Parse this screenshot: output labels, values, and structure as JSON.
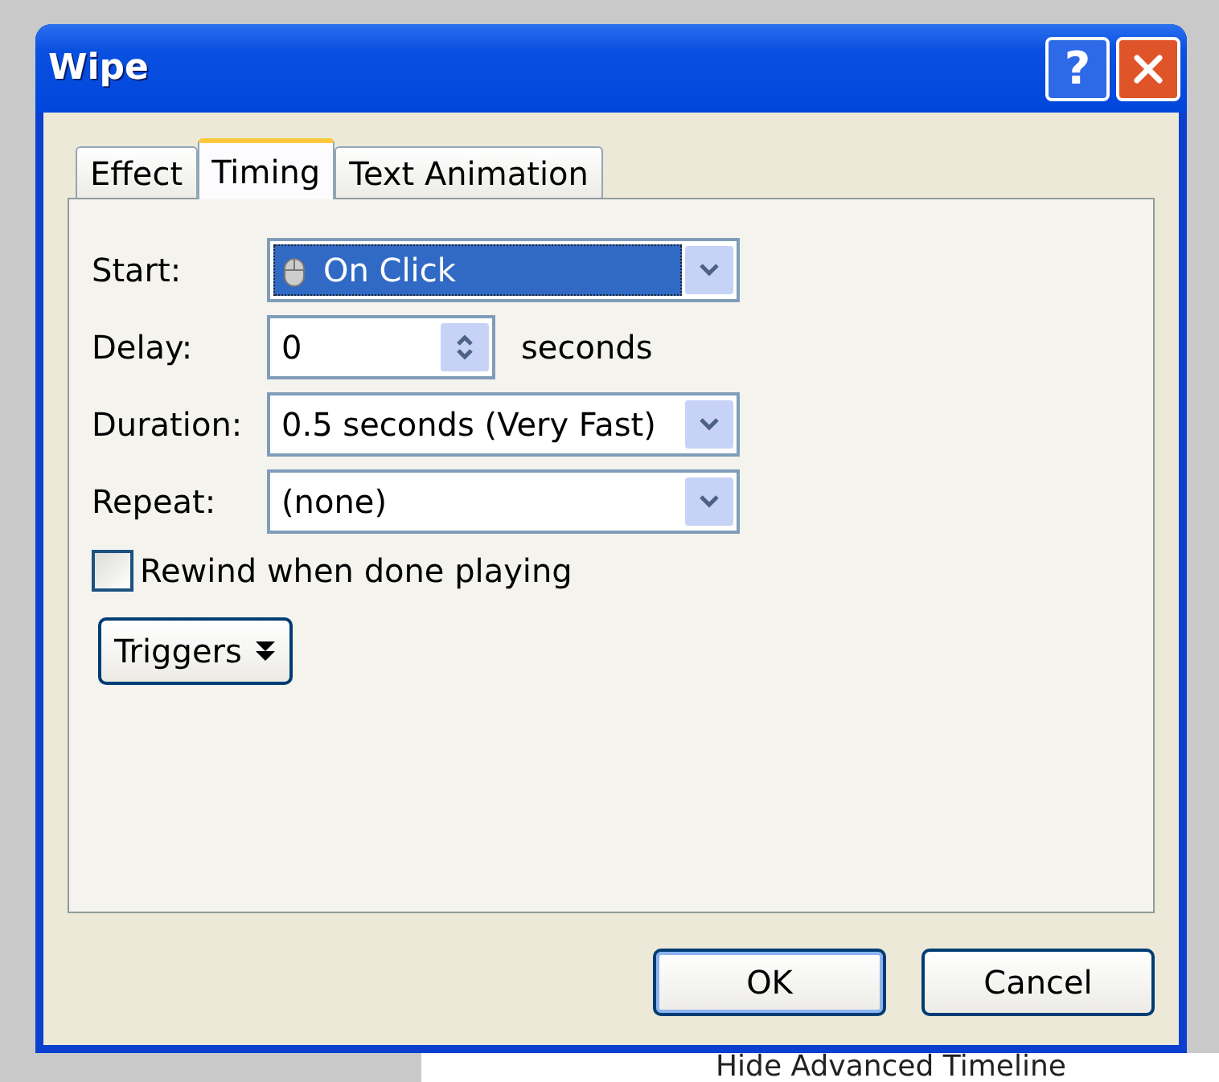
{
  "window": {
    "title": "Wipe",
    "help_button": "?"
  },
  "tabs": [
    {
      "label": "Effect",
      "selected": false
    },
    {
      "label": "Timing",
      "selected": true
    },
    {
      "label": "Text Animation",
      "selected": false
    }
  ],
  "fields": [
    {
      "kind": "dropdown",
      "label": "Start:",
      "value": "On Click",
      "highlighted": true
    },
    {
      "kind": "spinner",
      "label": "Delay:",
      "value": "0",
      "unit": "seconds"
    },
    {
      "kind": "dropdown",
      "label": "Duration:",
      "value": "0.5 seconds (Very Fast)",
      "highlighted": false
    },
    {
      "kind": "dropdown",
      "label": "Repeat:",
      "value": "(none)",
      "highlighted": false
    }
  ],
  "rewind": {
    "label": "Rewind when done playing",
    "checked": false
  },
  "triggers_button": "Triggers",
  "buttons": [
    "OK",
    "Cancel"
  ],
  "background": {
    "link": "Hide Advanced Timeline"
  }
}
